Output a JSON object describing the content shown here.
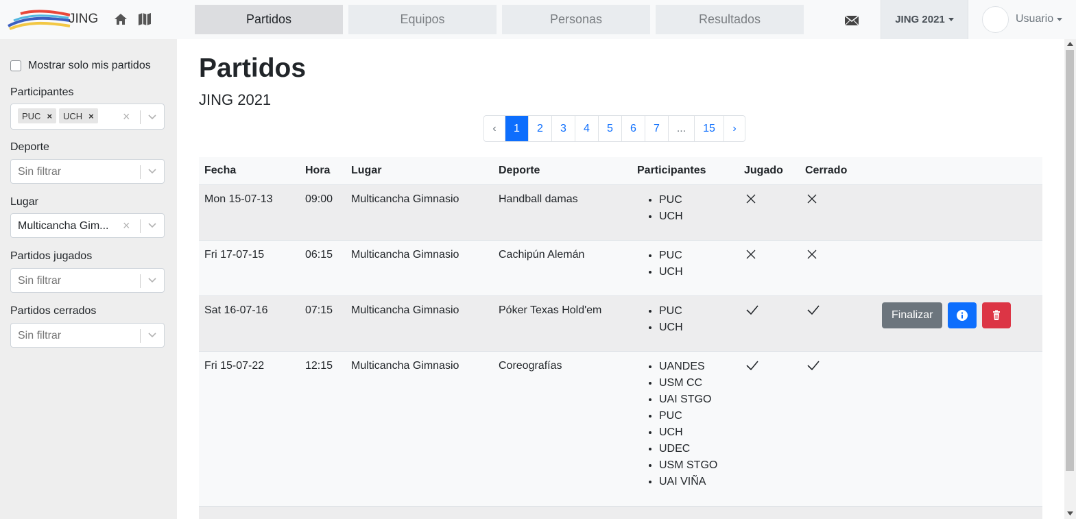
{
  "app": {
    "logo_text": "JING"
  },
  "nav": {
    "tabs": [
      {
        "label": "Partidos"
      },
      {
        "label": "Equipos"
      },
      {
        "label": "Personas"
      },
      {
        "label": "Resultados"
      }
    ],
    "season_label": "JING 2021",
    "user_label": "Usuario"
  },
  "filters": {
    "only_mine_label": "Mostrar solo mis partidos",
    "participants": {
      "label": "Participantes",
      "chips": [
        "PUC",
        "UCH"
      ]
    },
    "sport": {
      "label": "Deporte",
      "placeholder": "Sin filtrar"
    },
    "place": {
      "label": "Lugar",
      "value": "Multicancha Gim..."
    },
    "played": {
      "label": "Partidos jugados",
      "placeholder": "Sin filtrar"
    },
    "closed": {
      "label": "Partidos cerrados",
      "placeholder": "Sin filtrar"
    }
  },
  "page": {
    "title": "Partidos",
    "subtitle": "JING 2021"
  },
  "pagination": {
    "prev": "‹",
    "pages": [
      "1",
      "2",
      "3",
      "4",
      "5",
      "6",
      "7",
      "...",
      "15"
    ],
    "next": "›",
    "active": "1"
  },
  "table": {
    "headers": [
      "Fecha",
      "Hora",
      "Lugar",
      "Deporte",
      "Participantes",
      "Jugado",
      "Cerrado"
    ],
    "rows": [
      {
        "fecha": "Mon 15-07-13",
        "hora": "09:00",
        "lugar": "Multicancha Gimnasio",
        "deporte": "Handball damas",
        "participantes": [
          "PUC",
          "UCH"
        ],
        "jugado": false,
        "cerrado": false
      },
      {
        "fecha": "Fri 17-07-15",
        "hora": "06:15",
        "lugar": "Multicancha Gimnasio",
        "deporte": "Cachipún Alemán",
        "participantes": [
          "PUC",
          "UCH"
        ],
        "jugado": false,
        "cerrado": false
      },
      {
        "fecha": "Sat 16-07-16",
        "hora": "07:15",
        "lugar": "Multicancha Gimnasio",
        "deporte": "Póker Texas Hold'em",
        "participantes": [
          "PUC",
          "UCH"
        ],
        "jugado": true,
        "cerrado": true,
        "actions": {
          "finalize_label": "Finalizar"
        }
      },
      {
        "fecha": "Fri 15-07-22",
        "hora": "12:15",
        "lugar": "Multicancha Gimnasio",
        "deporte": "Coreografías",
        "participantes": [
          "UANDES",
          "USM CC",
          "UAI STGO",
          "PUC",
          "UCH",
          "UDEC",
          "USM STGO",
          "UAI VIÑA"
        ],
        "jugado": true,
        "cerrado": true
      }
    ]
  }
}
